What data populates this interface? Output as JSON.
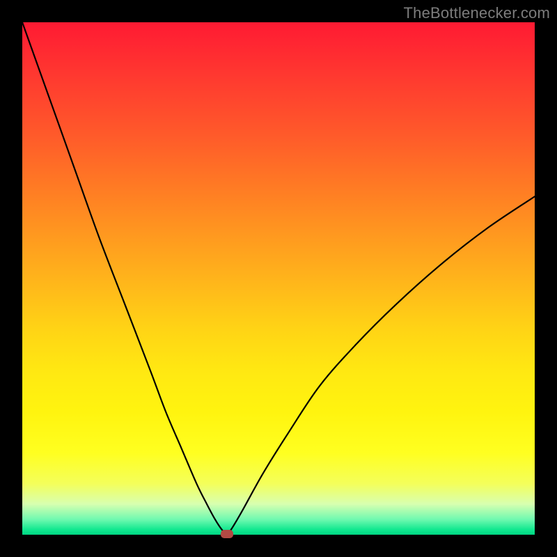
{
  "watermark": {
    "text": "TheBottlenecker.com"
  },
  "colors": {
    "top": "#ff1a33",
    "mid": "#ffe812",
    "bottom": "#00d683",
    "curve": "#000000",
    "marker": "#b24a44",
    "frame": "#000000"
  },
  "chart_data": {
    "type": "line",
    "title": "",
    "xlabel": "",
    "ylabel": "",
    "xlim": [
      0,
      100
    ],
    "ylim": [
      0,
      100
    ],
    "series": [
      {
        "name": "bottleneck-curve",
        "x": [
          0,
          5,
          10,
          15,
          20,
          25,
          28,
          31,
          34,
          36,
          37.5,
          38.5,
          39.3,
          40,
          41,
          43,
          47,
          52,
          58,
          65,
          73,
          82,
          91,
          100
        ],
        "y": [
          100,
          86,
          72,
          58,
          45,
          32,
          24,
          17,
          10,
          6,
          3.2,
          1.6,
          0.6,
          0.1,
          1.4,
          4.8,
          12,
          20,
          29,
          37,
          45,
          53,
          60,
          66
        ]
      }
    ],
    "annotations": [
      {
        "name": "optimal-point",
        "x": 40,
        "y": 0.1
      }
    ],
    "grid": false,
    "legend": false
  }
}
